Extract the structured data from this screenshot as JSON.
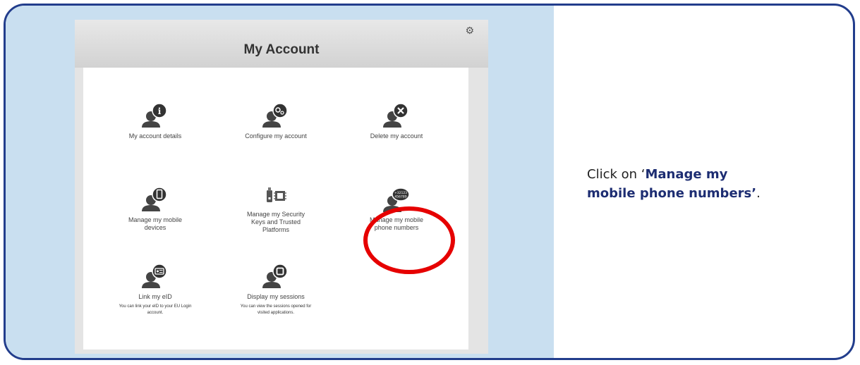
{
  "header": {
    "title": "My Account",
    "settings_icon": "gear-icon"
  },
  "tiles": [
    {
      "label": "My account details",
      "icon": "user-info-icon"
    },
    {
      "label": "Configure my account",
      "icon": "user-gears-icon"
    },
    {
      "label": "Delete my account",
      "icon": "user-delete-icon"
    },
    {
      "label": "Manage my mobile devices",
      "icon": "user-mobile-icon"
    },
    {
      "label": "Manage my Security Keys and Trusted Platforms",
      "icon": "security-key-chip-icon"
    },
    {
      "label": "Manage my mobile phone numbers",
      "icon": "user-phone-number-icon",
      "badge": "+32123 456789"
    },
    {
      "label": "Link my eID",
      "icon": "user-id-card-icon",
      "description": "You can link your eID to your EU Login account."
    },
    {
      "label": "Display my sessions",
      "icon": "user-session-icon",
      "description": "You can view the sessions opened for visited applications."
    }
  ],
  "instruction": {
    "prefix": "Click on ‘",
    "highlight": "Manage my mobile phone numbers’",
    "suffix": "."
  },
  "colors": {
    "border": "#223d8c",
    "left_panel": "#c9dff0",
    "highlight_ring": "#e60000",
    "instruction_bold": "#1d2d72"
  }
}
